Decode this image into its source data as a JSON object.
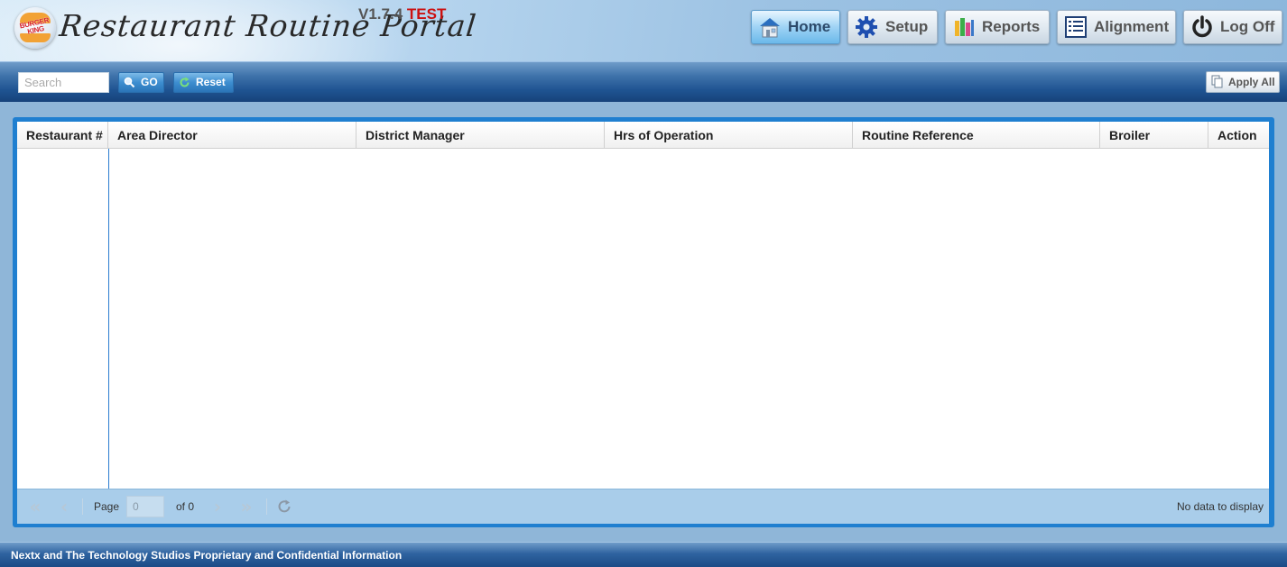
{
  "header": {
    "logo_text": "BURGER KING",
    "app_title": "Restaurant Routine Portal",
    "version": "V1.7.4",
    "environment": "TEST",
    "nav": [
      {
        "label": "Home",
        "icon": "home-icon",
        "active": true
      },
      {
        "label": "Setup",
        "icon": "gear-icon",
        "active": false
      },
      {
        "label": "Reports",
        "icon": "reports-icon",
        "active": false
      },
      {
        "label": "Alignment",
        "icon": "list-icon",
        "active": false
      },
      {
        "label": "Log Off",
        "icon": "power-icon",
        "active": false
      }
    ]
  },
  "toolbar": {
    "search_placeholder": "Search",
    "search_value": "",
    "go_label": "GO",
    "reset_label": "Reset",
    "apply_all_label": "Apply All"
  },
  "grid": {
    "columns": [
      "Restaurant #",
      "Area Director",
      "District Manager",
      "Hrs of Operation",
      "Routine Reference",
      "Broiler",
      "Action"
    ],
    "rows": []
  },
  "pager": {
    "page_label": "Page",
    "page_value": "0",
    "of_label": "of 0",
    "status": "No data to display"
  },
  "footer": {
    "text": "Nextx and The Technology Studios Proprietary and Confidential Information"
  },
  "colors": {
    "toolbar_blue": "#1f5492",
    "grid_border": "#1f7fd0",
    "pager_bg": "#a9cdea",
    "env_red": "#cc1010"
  }
}
